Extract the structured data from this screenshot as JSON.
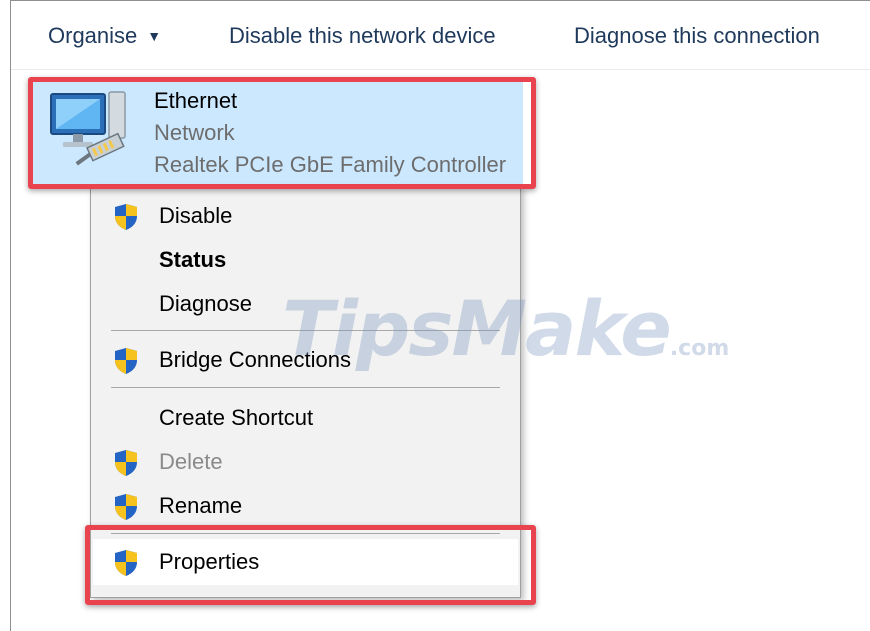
{
  "toolbar": {
    "organise_label": "Organise",
    "disable_label": "Disable this network device",
    "diagnose_label": "Diagnose this connection"
  },
  "item": {
    "name": "Ethernet",
    "type": "Network",
    "controller": "Realtek PCIe GbE Family Controller"
  },
  "menu": {
    "disable": "Disable",
    "status": "Status",
    "diagnose": "Diagnose",
    "bridge": "Bridge Connections",
    "create_shortcut": "Create Shortcut",
    "delete": "Delete",
    "rename": "Rename",
    "properties": "Properties"
  },
  "watermark": {
    "main": "TipsMake",
    "suffix": ".com"
  },
  "colors": {
    "highlight": "#e8434f",
    "selected_bg": "#cce8ff",
    "menu_bg": "#f2f2f2"
  }
}
